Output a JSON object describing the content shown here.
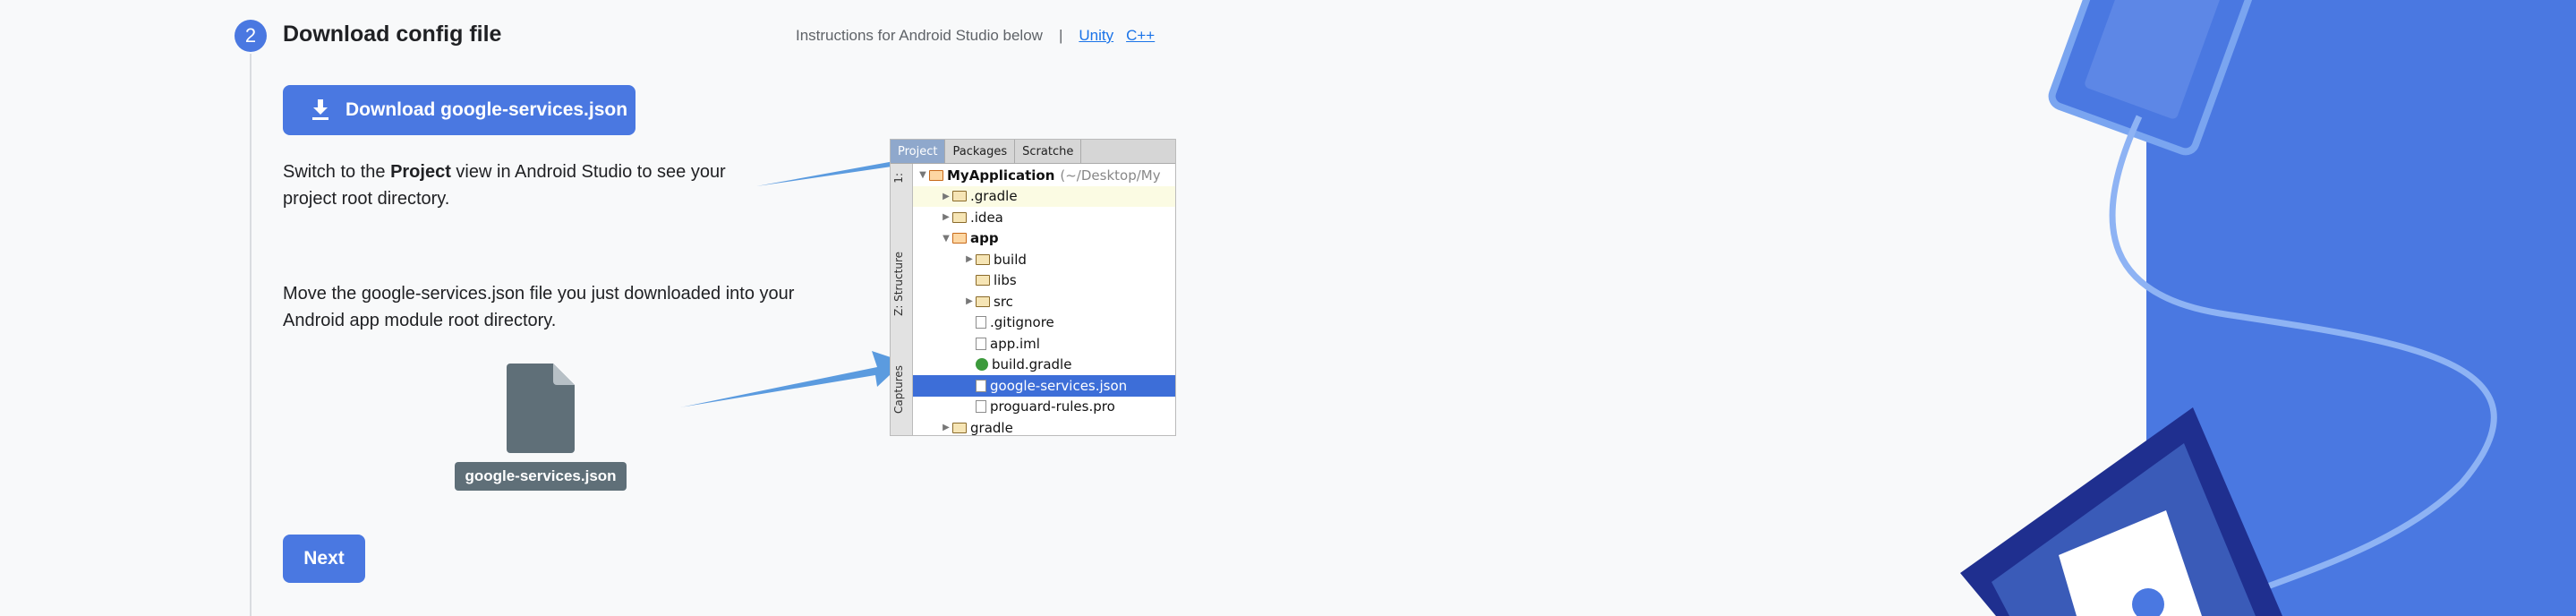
{
  "step": {
    "number": "2",
    "title": "Download config file"
  },
  "instructions": {
    "text": "Instructions for Android Studio below",
    "separator": "|",
    "links": [
      "Unity",
      "C++"
    ]
  },
  "download_button": {
    "label": "Download google-services.json",
    "icon": "download-icon"
  },
  "paragraph1": {
    "before": "Switch to the ",
    "bold": "Project",
    "after": " view in Android Studio to see your project root directory."
  },
  "paragraph2": "Move the google-services.json file you just downloaded into your Android app module root directory.",
  "file_chip": {
    "label": "google-services.json",
    "icon": "file-icon"
  },
  "next_button": {
    "label": "Next"
  },
  "ide": {
    "tabs": [
      "Project",
      "Packages",
      "Scratche"
    ],
    "side_labels": [
      "1:",
      "Z: Structure",
      "Captures"
    ],
    "tree": [
      {
        "label": "MyApplication",
        "extra": "(~/Desktop/My",
        "depth": 0,
        "expanded": true,
        "icon": "project-folder-icon",
        "bold": true
      },
      {
        "label": ".gradle",
        "depth": 1,
        "expanded": false,
        "icon": "folder-icon"
      },
      {
        "label": ".idea",
        "depth": 1,
        "expanded": false,
        "icon": "folder-icon"
      },
      {
        "label": "app",
        "depth": 1,
        "expanded": true,
        "icon": "module-folder-icon",
        "bold": true
      },
      {
        "label": "build",
        "depth": 2,
        "expanded": false,
        "icon": "folder-icon"
      },
      {
        "label": "libs",
        "depth": 2,
        "icon": "folder-icon"
      },
      {
        "label": "src",
        "depth": 2,
        "expanded": false,
        "icon": "folder-icon"
      },
      {
        "label": ".gitignore",
        "depth": 2,
        "icon": "file-icon"
      },
      {
        "label": "app.iml",
        "depth": 2,
        "icon": "file-icon"
      },
      {
        "label": "build.gradle",
        "depth": 2,
        "icon": "gradle-icon"
      },
      {
        "label": "google-services.json",
        "depth": 2,
        "icon": "json-file-icon",
        "selected": true
      },
      {
        "label": "proguard-rules.pro",
        "depth": 2,
        "icon": "file-icon"
      },
      {
        "label": "gradle",
        "depth": 1,
        "expanded": false,
        "icon": "folder-icon"
      }
    ]
  },
  "colors": {
    "accent": "#4a78e1",
    "selection": "#3d6ed8",
    "arrow": "#5b9bdf",
    "file_chip": "#5f6f78"
  }
}
